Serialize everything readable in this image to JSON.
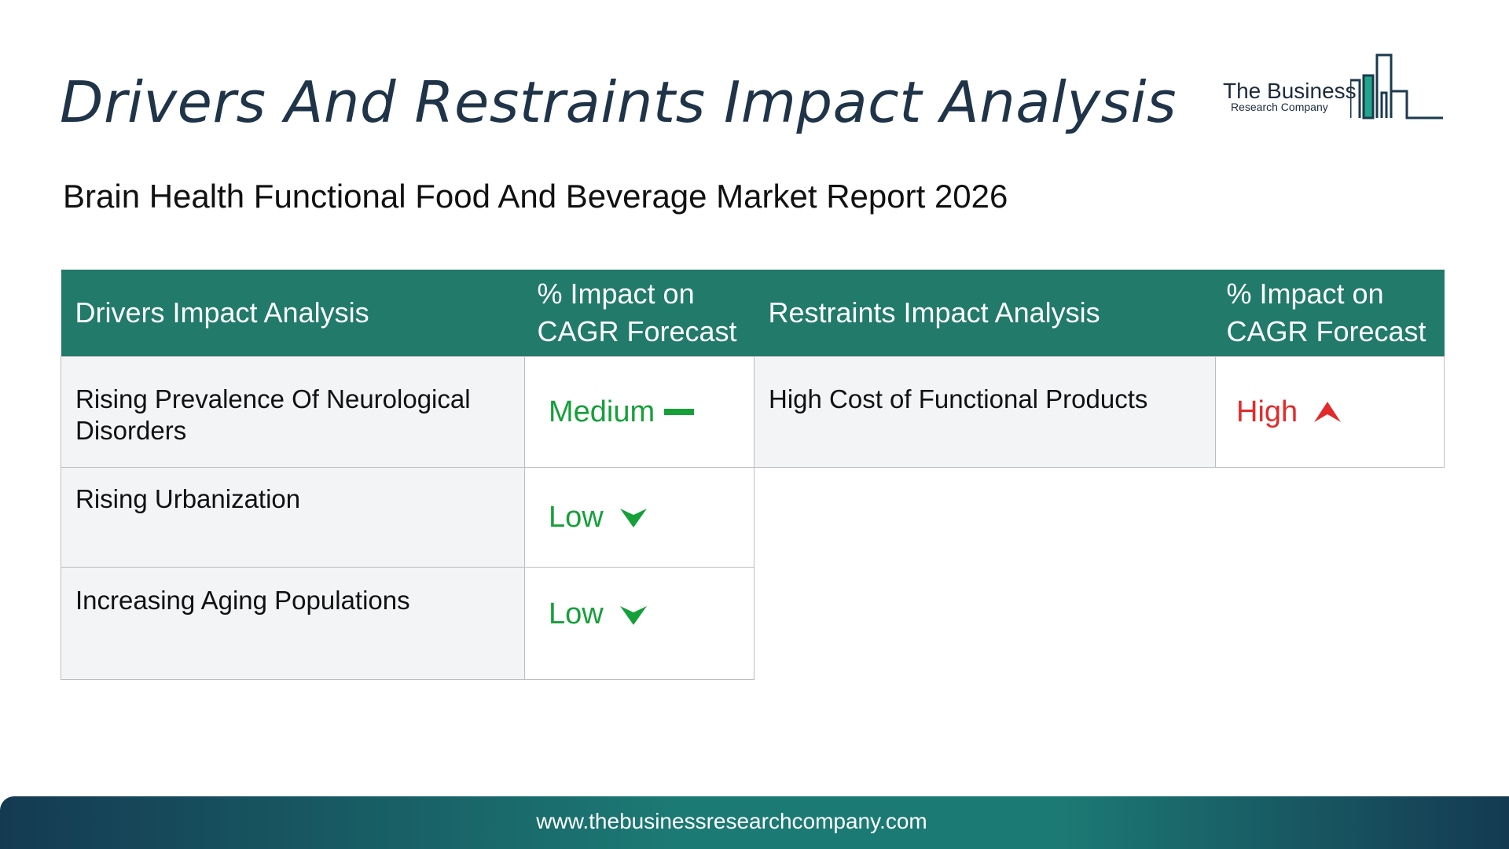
{
  "title": "Drivers And Restraints Impact Analysis",
  "subtitle": "Brain Health Functional Food And Beverage Market Report 2026",
  "logo": {
    "line1": "The Business",
    "line2": "Research Company"
  },
  "drivers_table": {
    "headers": [
      "Drivers Impact Analysis",
      "% Impact on CAGR Forecast"
    ],
    "rows": [
      {
        "label": "Rising Prevalence Of Neurological Disorders",
        "impact": "Medium",
        "indicator": "dash-icon"
      },
      {
        "label": "Rising Urbanization",
        "impact": "Low",
        "indicator": "chevron-down-icon"
      },
      {
        "label": "Increasing Aging Populations",
        "impact": "Low",
        "indicator": "chevron-down-icon"
      }
    ]
  },
  "restraints_table": {
    "headers": [
      "Restraints Impact Analysis",
      "% Impact on CAGR Forecast"
    ],
    "rows": [
      {
        "label": "High Cost of Functional Products",
        "impact": "High",
        "indicator": "arrow-up-icon"
      }
    ]
  },
  "colors": {
    "header_bg": "#217a6a",
    "positive": "#16a03a",
    "negative": "#e32a2a",
    "title": "#1f3448"
  },
  "footer": {
    "url": "www.thebusinessresearchcompany.com"
  }
}
